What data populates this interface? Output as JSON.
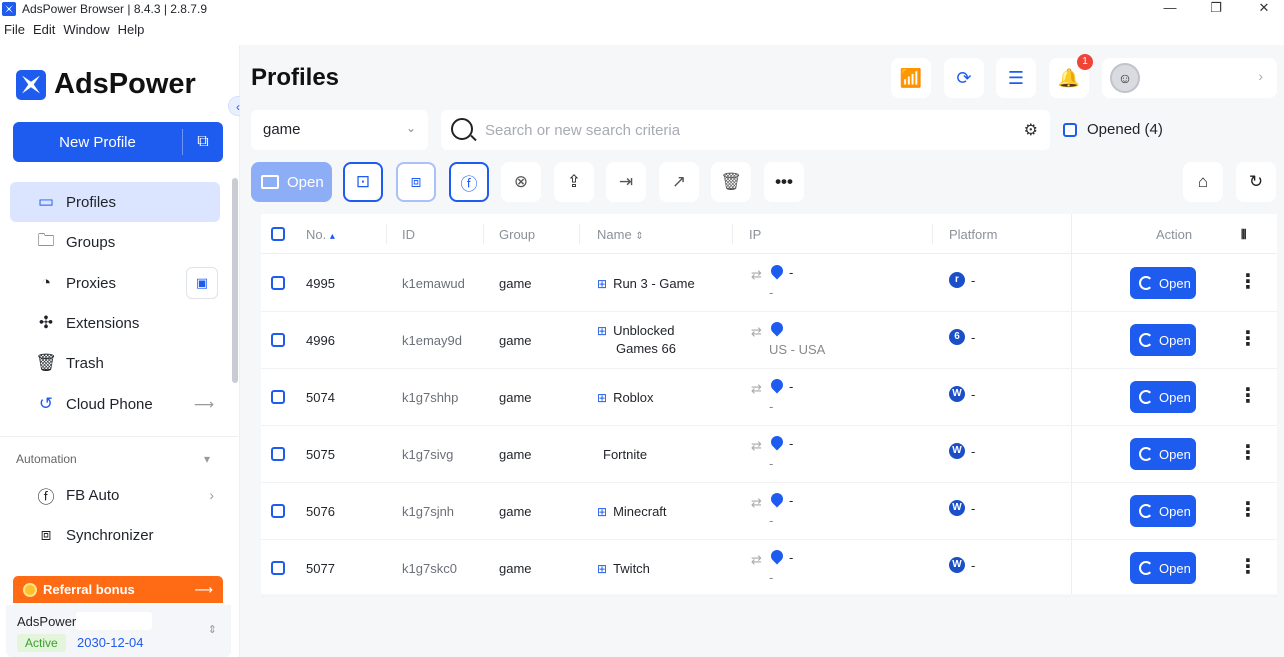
{
  "app": {
    "title": "AdsPower Browser | 8.4.3 | 2.8.7.9"
  },
  "menu": [
    "File",
    "Edit",
    "Window",
    "Help"
  ],
  "window_controls": {
    "minimize": "—",
    "restore": "❐",
    "close": "✕"
  },
  "brand": {
    "name": "AdsPower"
  },
  "sidebar": {
    "new_profile_label": "New Profile",
    "items": [
      {
        "label": "Profiles",
        "icon": "profiles-icon"
      },
      {
        "label": "Groups",
        "icon": "folder-icon"
      },
      {
        "label": "Proxies",
        "icon": "proxies-icon"
      },
      {
        "label": "Extensions",
        "icon": "puzzle-icon"
      },
      {
        "label": "Trash",
        "icon": "trash-icon"
      },
      {
        "label": "Cloud Phone",
        "icon": "cloud-phone-icon"
      }
    ],
    "section_automation": "Automation",
    "automation_items": [
      {
        "label": "FB Auto",
        "icon": "facebook-auto-icon"
      },
      {
        "label": "Synchronizer",
        "icon": "synchronizer-icon"
      }
    ],
    "referral_label": "Referral bonus",
    "account": {
      "name": "AdsPower",
      "status": "Active",
      "expiry": "2030-12-04"
    }
  },
  "header": {
    "title": "Profiles",
    "notification_count": "1"
  },
  "filters": {
    "group_value": "game",
    "search_placeholder": "Search or new search criteria",
    "opened_label": "Opened (4)"
  },
  "toolbar": {
    "open_label": "Open"
  },
  "table": {
    "columns": [
      "No.",
      "ID",
      "Group",
      "Name",
      "IP",
      "Platform",
      "Action"
    ],
    "rows": [
      {
        "no": "4995",
        "id": "k1emawud",
        "group": "game",
        "name_line1": "Run 3 - Game",
        "name_line2": "",
        "os": "windows",
        "os_glyph": "⊞",
        "ip_top": "-",
        "ip_bottom": "-",
        "platform": "r",
        "platform_dash": "-",
        "action": "Open"
      },
      {
        "no": "4996",
        "id": "k1emay9d",
        "group": "game",
        "name_line1": "Unblocked",
        "name_line2": "Games 66",
        "os": "windows",
        "os_glyph": "⊞",
        "ip_top": "",
        "ip_bottom": "US - USA",
        "platform": "6",
        "platform_dash": "-",
        "action": "Open"
      },
      {
        "no": "5074",
        "id": "k1g7shhp",
        "group": "game",
        "name_line1": "Roblox",
        "name_line2": "",
        "os": "windows",
        "os_glyph": "⊞",
        "ip_top": "-",
        "ip_bottom": "-",
        "platform": "W",
        "platform_dash": "-",
        "action": "Open"
      },
      {
        "no": "5075",
        "id": "k1g7sivg",
        "group": "game",
        "name_line1": "Fortnite",
        "name_line2": "",
        "os": "apple",
        "os_glyph": "",
        "ip_top": "-",
        "ip_bottom": "-",
        "platform": "W",
        "platform_dash": "-",
        "action": "Open"
      },
      {
        "no": "5076",
        "id": "k1g7sjnh",
        "group": "game",
        "name_line1": "Minecraft",
        "name_line2": "",
        "os": "windows",
        "os_glyph": "⊞",
        "ip_top": "-",
        "ip_bottom": "-",
        "platform": "W",
        "platform_dash": "-",
        "action": "Open"
      },
      {
        "no": "5077",
        "id": "k1g7skc0",
        "group": "game",
        "name_line1": "Twitch",
        "name_line2": "",
        "os": "windows",
        "os_glyph": "⊞",
        "ip_top": "-",
        "ip_bottom": "-",
        "platform": "W",
        "platform_dash": "-",
        "action": "Open"
      }
    ]
  }
}
